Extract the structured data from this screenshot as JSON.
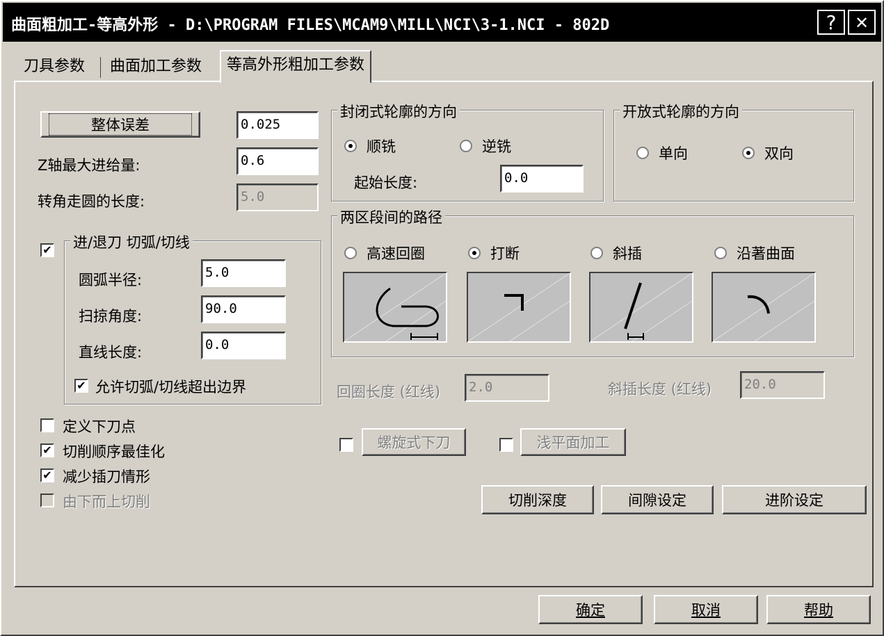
{
  "window": {
    "title": "曲面粗加工-等高外形 - D:\\PROGRAM FILES\\MCAM9\\MILL\\NCI\\3-1.NCI - 802D",
    "help_glyph": "?",
    "close_glyph": "✕"
  },
  "tabs": [
    "刀具参数",
    "曲面加工参数",
    "等高外形粗加工参数"
  ],
  "left": {
    "tolerance_button": "整体误差",
    "tolerance_value": "0.025",
    "z_max_label": "Z轴最大进给量:",
    "z_max_value": "0.6",
    "corner_label": "转角走圆的长度:",
    "corner_value": "5.0",
    "entry_group_title": "进/退刀 切弧/切线",
    "arc_radius_label": "圆弧半径:",
    "arc_radius_value": "5.0",
    "sweep_label": "扫掠角度:",
    "sweep_value": "90.0",
    "line_len_label": "直线长度:",
    "line_len_value": "0.0",
    "allow_exceed_label": "允许切弧/切线超出边界",
    "define_entry_label": "定义下刀点",
    "optimize_label": "切削顺序最佳化",
    "reduce_plunge_label": "减少插刀情形",
    "bottom_up_label": "由下而上切削",
    "check_mark": "✔"
  },
  "closed": {
    "title": "封闭式轮廓的方向",
    "climb": "顺铣",
    "conventional": "逆铣",
    "start_len_label": "起始长度:",
    "start_len_value": "0.0"
  },
  "open": {
    "title": "开放式轮廓的方向",
    "one_way": "单向",
    "zigzag": "双向"
  },
  "transition": {
    "title": "两区段间的路径",
    "options": [
      "高速回圈",
      "打断",
      "斜插",
      "沿著曲面"
    ]
  },
  "loop_len_label": "回圈长度 (红线)",
  "loop_len_value": "2.0",
  "ramp_len_label": "斜插长度 (红线)",
  "ramp_len_value": "20.0",
  "helix_button": "螺旋式下刀",
  "shallow_button": "浅平面加工",
  "depth_button": "切削深度",
  "gap_button": "间隙设定",
  "advanced_button": "进阶设定",
  "ok_button": "确定",
  "cancel_button": "取消",
  "help_button": "帮助"
}
